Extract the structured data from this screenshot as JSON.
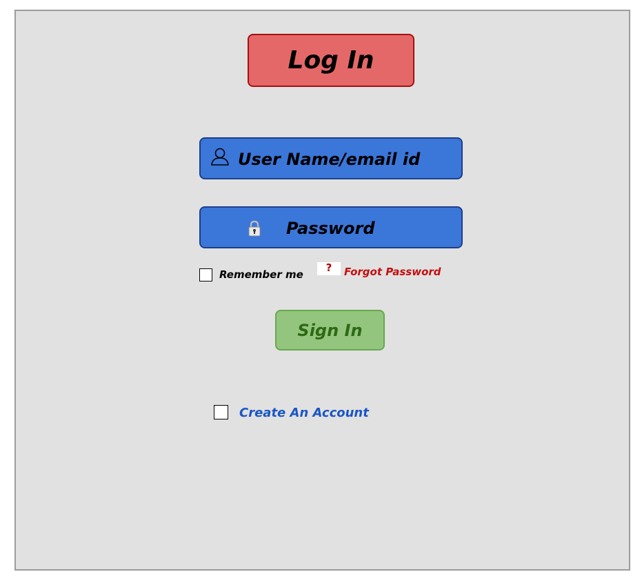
{
  "header": {
    "title": "Log In"
  },
  "form": {
    "username": {
      "label": "User Name/email id",
      "icon": "user-icon"
    },
    "password": {
      "label": "Password",
      "icon": "lock-icon"
    },
    "remember_me": {
      "label": "Remember me",
      "checked": false
    },
    "forgot_password": {
      "icon_glyph": "?",
      "icon": "help-icon",
      "label": "Forgot Password"
    },
    "sign_in_label": "Sign In",
    "create_account": {
      "label": "Create An Account",
      "checked": false
    }
  },
  "colors": {
    "panel_bg": "#e1e1e1",
    "title_bg": "#e46868",
    "field_bg": "#3b76d9",
    "sign_in_bg": "#94c57f",
    "sign_in_text": "#2e6a14",
    "forgot_text": "#c60f0f",
    "create_text": "#1a56c4"
  }
}
